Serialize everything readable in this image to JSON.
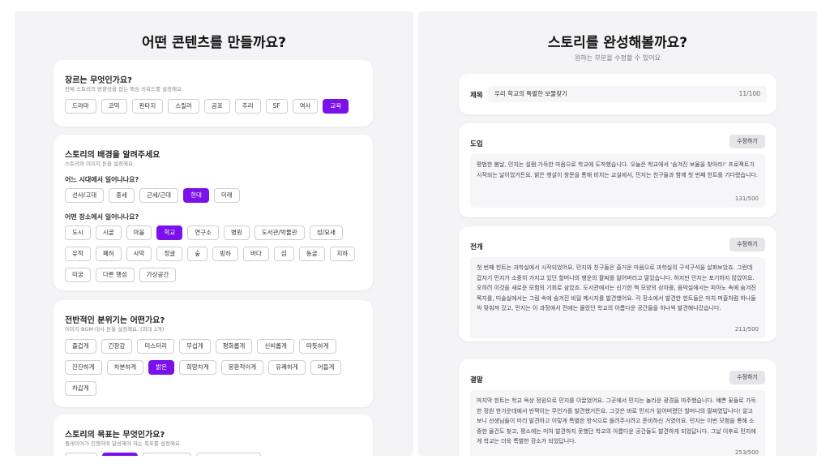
{
  "left": {
    "title": "어떤 콘텐츠를 만들까요?",
    "genre": {
      "title": "장르는 무엇인가요?",
      "desc": "전체 스토리의 방향성을 잡는 핵심 키워드를 설정해요.",
      "options": [
        "드라마",
        "코믹",
        "판타지",
        "스릴러",
        "공포",
        "추리",
        "SF",
        "역사",
        "교육"
      ],
      "selected": [
        "교육"
      ]
    },
    "background": {
      "title": "스토리의 배경을 알려주세요",
      "desc": "스토리와 이미지 톤을 설정해요.",
      "era_label": "어느 시대에서 일어나나요?",
      "eras": [
        "선사/고대",
        "중세",
        "근세/근대",
        "현대",
        "미래"
      ],
      "era_selected": [
        "현대"
      ],
      "place_label": "어떤 장소에서 일어나나요?",
      "places": [
        "도시",
        "시골",
        "마을",
        "학교",
        "연구소",
        "병원",
        "도서관/박물관",
        "성/요새",
        "유적",
        "폐허",
        "사막",
        "정글",
        "숲",
        "빙하",
        "바다",
        "섬",
        "동굴",
        "지하",
        "미궁",
        "다른 행성",
        "가상공간"
      ],
      "place_selected": [
        "학교"
      ]
    },
    "mood": {
      "title": "전반적인 분위기는 어떤가요?",
      "desc": "이미지·BGM·대사 톤을 설정해요. (최대 2개)",
      "options": [
        "즐겁게",
        "긴장감",
        "미스터리",
        "무섭게",
        "평화롭게",
        "신비롭게",
        "따뜻하게",
        "잔잔하게",
        "차분하게",
        "밝은",
        "희망차게",
        "몽환적이게",
        "유쾌하게",
        "어둡게",
        "차갑게"
      ],
      "selected": [
        "밝은"
      ]
    },
    "goal": {
      "title": "스토리의 목표는 무엇인가요?",
      "desc": "플레이어가 진행하며 달성해야 하는 목표를 설정해요"
    }
  },
  "right": {
    "title": "스토리를 완성해볼까요?",
    "subtitle": "원하는 부분을 수정할 수 있어요",
    "story_title": {
      "label": "제목",
      "value": "우리 학교의 특별한 보물찾기",
      "count": "11/100"
    },
    "edit_label": "수정하기",
    "intro": {
      "label": "도입",
      "text": "평범한 봄날, 민지는 설렘 가득한 마음으로 학교에 도착했습니다. 오늘은 학교에서 '숨겨진 보물을 찾아라!' 프로젝트가 시작되는 날이었거든요. 밝은 햇살이 창문을 통해 비치는 교실에서, 민지는 친구들과 함께 첫 번째 힌트를 기다렸습니다.",
      "count": "131/500"
    },
    "development": {
      "label": "전개",
      "text": "첫 번째 힌트는 과학실에서 시작되었어요. 민지와 친구들은 즐거운 마음으로 과학실의 구석구석을 살펴보았죠. 그런데 갑자기 민지가 소중히 가지고 있던 할머니의 행운의 팔찌를 잃어버리고 말았습니다. 하지만 민지는 포기하지 않았어요. 오히려 이것을 새로운 모험의 기회로 삼았죠. 도서관에서는 신기한 책 모양의 상자를, 음악실에서는 피아노 속에 숨겨진 쪽지를, 미술실에서는 그림 속에 숨겨진 비밀 메시지를 발견했어요. 각 장소에서 발견한 힌트들은 마치 퍼즐처럼 하나둘씩 맞춰져 갔고, 민지는 이 과정에서 전에는 몰랐던 학교의 아름다운 공간들을 하나씩 발견해나갔습니다.",
      "count": "211/500"
    },
    "ending": {
      "label": "결말",
      "text": "마지막 힌트는 학교 옥상 정원으로 민지를 이끌었어요. 그곳에서 민지는 놀라운 광경을 마주했습니다. 예쁜 꽃들로 가득한 정원 한가운데에서 반짝이는 무언가를 발견했거든요. 그것은 바로 민지가 잃어버렸던 할머니의 팔찌였답니다! 알고 보니 선생님들이 미리 발견하고 이렇게 특별한 방식으로 돌려주시려고 준비하신 거였어요. 민지는 이번 모험을 통해 소중한 물건도 찾고, 평소에는 미처 발견하지 못했던 학교의 아름다운 공간들도 발견하게 되었답니다. 그날 이후로 민지에게 학교는 더욱 특별한 장소가 되었답니다.",
      "count": "253/500"
    }
  }
}
